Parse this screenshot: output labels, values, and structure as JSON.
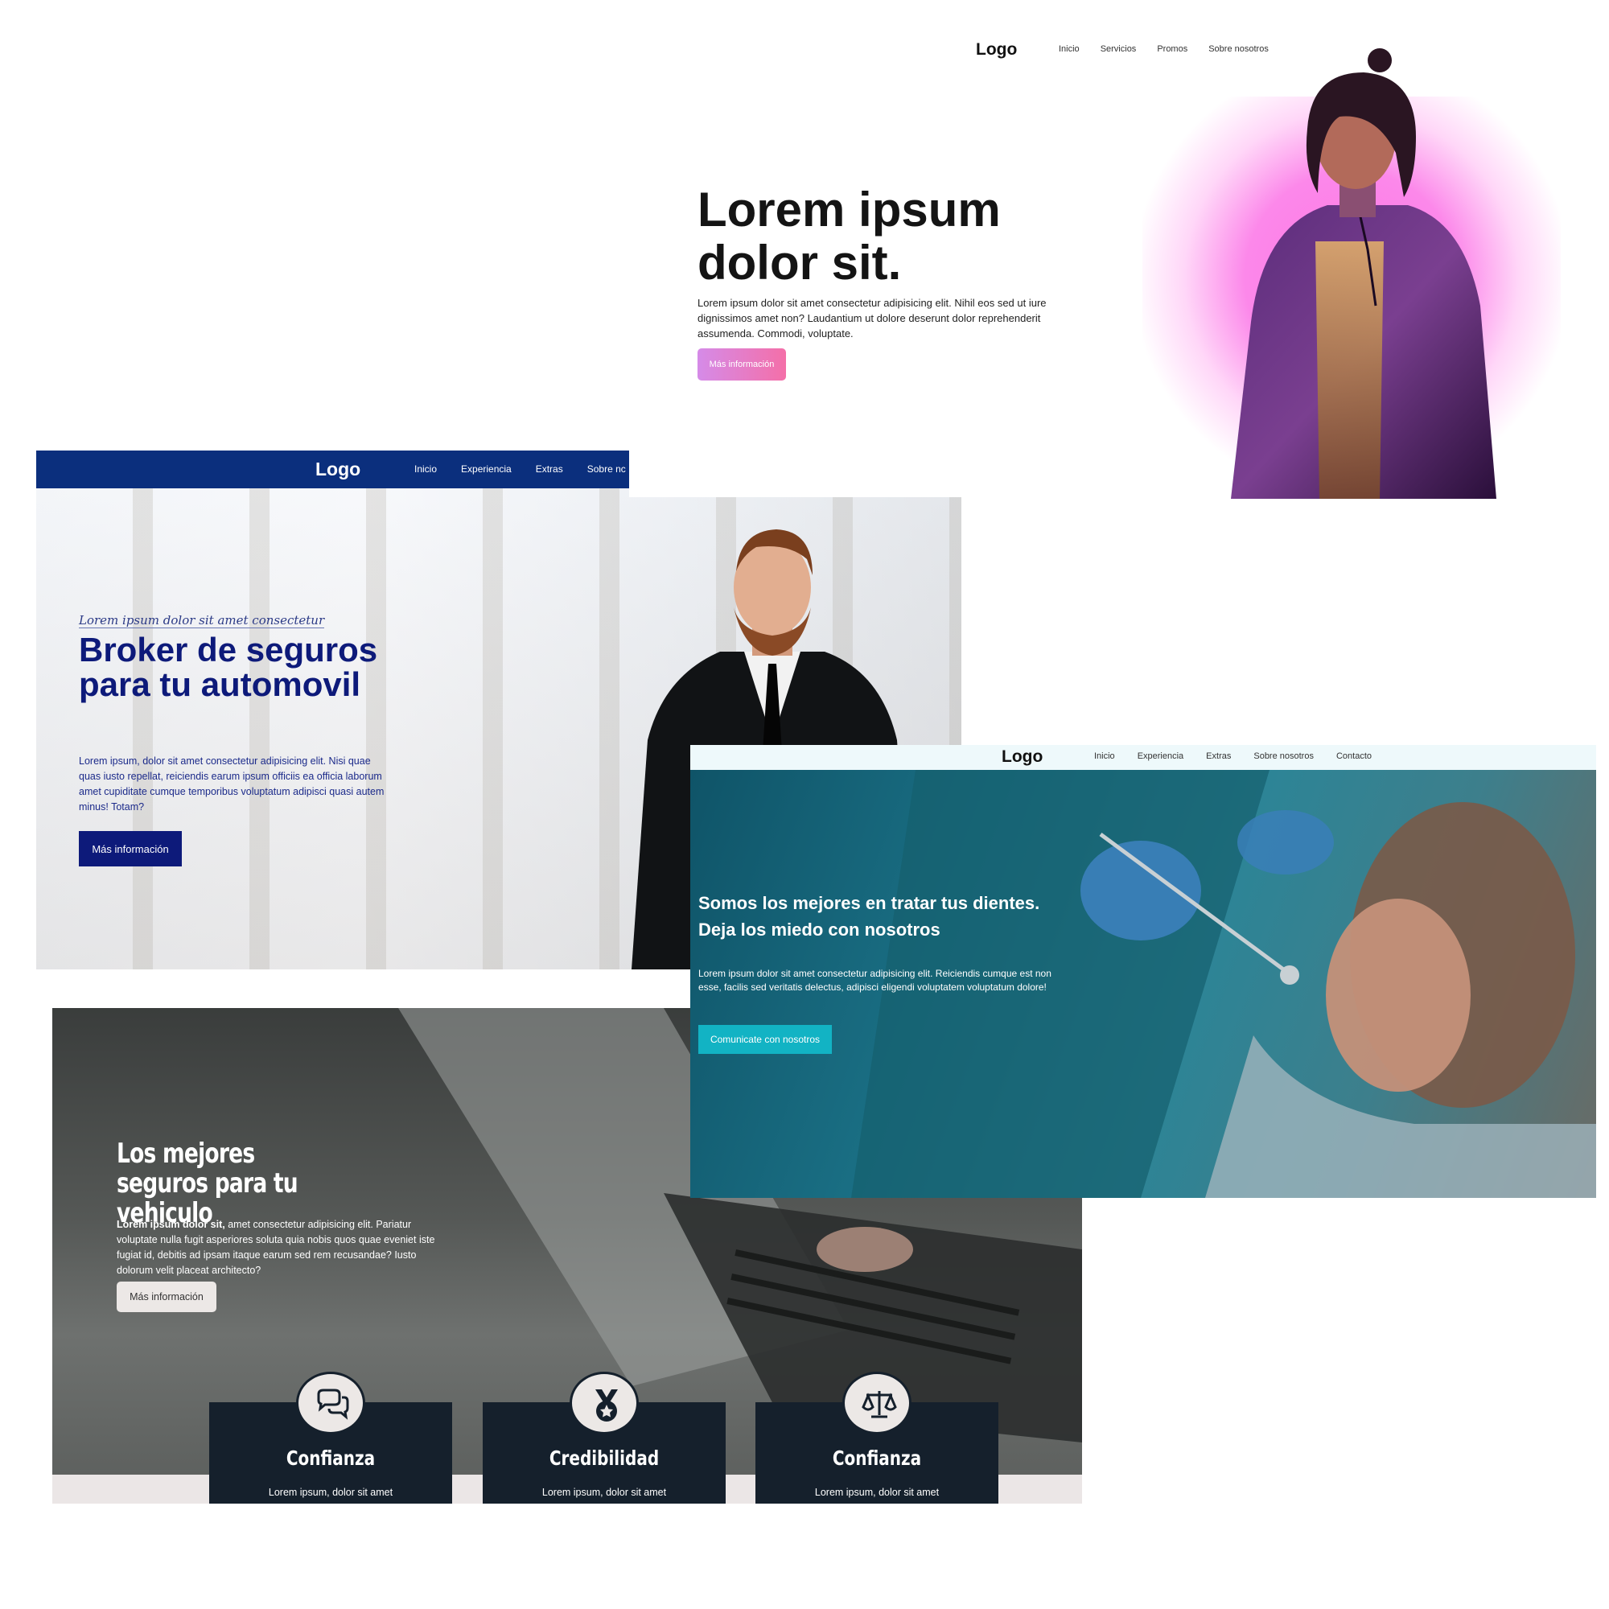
{
  "mockup_fashion": {
    "logo": "Logo",
    "nav": [
      "Inicio",
      "Servicios",
      "Promos",
      "Sobre nosotros"
    ],
    "title": "Lorem ipsum dolor sit.",
    "body": "Lorem ipsum dolor sit amet consectetur adipisicing elit. Nihil eos sed ut iure dignissimos amet non? Laudantium ut dolore deserunt dolor reprehenderit assumenda. Commodi, voluptate.",
    "button": "Más información"
  },
  "mockup_broker": {
    "logo": "Logo",
    "nav": [
      "Inicio",
      "Experiencia",
      "Extras",
      "Sobre nc"
    ],
    "script": "Lorem ipsum dolor sit amet consectetur",
    "title": "Broker de seguros para tu automovil",
    "body": "Lorem ipsum, dolor sit amet consectetur adipisicing elit. Nisi quae quas iusto repellat, reiciendis earum ipsum officiis ea officia laborum amet cupiditate cumque temporibus voluptatum adipisci quasi autem minus! Totam?",
    "button": "Más información"
  },
  "mockup_dentist": {
    "logo": "Logo",
    "nav": [
      "Inicio",
      "Experiencia",
      "Extras",
      "Sobre nosotros",
      "Contacto"
    ],
    "title": "Somos los mejores en tratar tus dientes. Deja los miedo con nosotros",
    "body": "Lorem ipsum dolor sit amet consectetur adipisicing elit. Reiciendis cumque est non esse, facilis sed veritatis delectus, adipisci eligendi voluptatem voluptatum dolore!",
    "button": "Comunicate con nosotros"
  },
  "mockup_vehicle": {
    "title": "Los mejores seguros para tu vehiculo",
    "body_bold": "Lorem ipsum dolor sit,",
    "body_rest": " amet consectetur adipisicing elit. Pariatur voluptate nulla fugit asperiores soluta quia nobis quos quae eveniet iste fugiat id, debitis ad ipsam itaque earum sed rem recusandae? Iusto dolorum velit placeat architecto?",
    "button": "Más información",
    "cards": [
      {
        "icon": "chat-bubbles-icon",
        "label": "Confianza",
        "desc": "Lorem ipsum, dolor sit amet"
      },
      {
        "icon": "medal-icon",
        "label": "Credibilidad",
        "desc": "Lorem ipsum, dolor sit amet"
      },
      {
        "icon": "scales-icon",
        "label": "Confianza",
        "desc": "Lorem ipsum, dolor sit amet"
      }
    ]
  },
  "colors": {
    "broker_navy": "#0b2f7d",
    "dentist_teal": "#12b3c4",
    "vehicle_card": "#15202c",
    "fashion_pink": "#f46fa8"
  }
}
